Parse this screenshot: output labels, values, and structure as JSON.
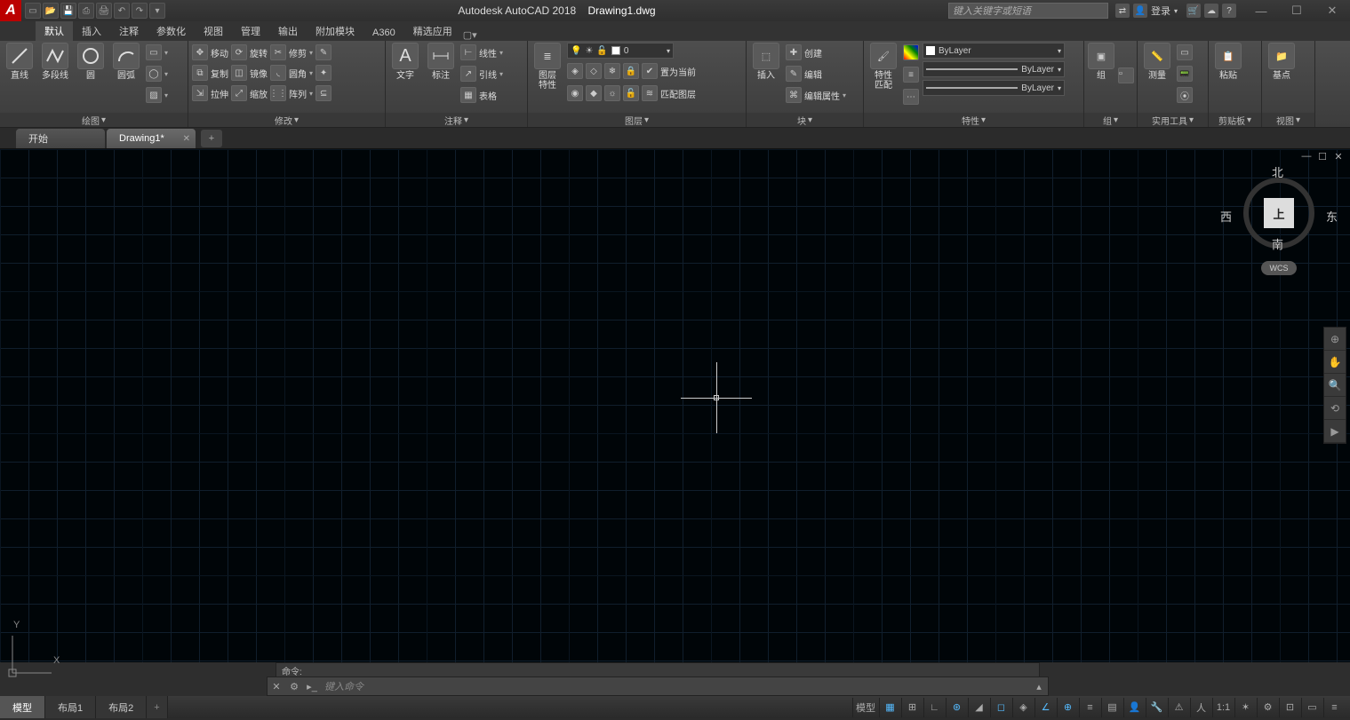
{
  "title": {
    "app": "Autodesk AutoCAD 2018",
    "file": "Drawing1.dwg"
  },
  "search": {
    "placeholder": "键入关键字或短语"
  },
  "login": {
    "label": "登录"
  },
  "window": {
    "min": "—",
    "max": "☐",
    "close": "✕"
  },
  "ribbon_tabs": [
    "默认",
    "插入",
    "注释",
    "参数化",
    "视图",
    "管理",
    "输出",
    "附加模块",
    "A360",
    "精选应用"
  ],
  "ribbon_tabs_active": 0,
  "panels": {
    "draw": {
      "title": "绘图",
      "big": [
        {
          "label": "直线",
          "icon": "line"
        },
        {
          "label": "多段线",
          "icon": "pline"
        },
        {
          "label": "圆",
          "icon": "circle"
        },
        {
          "label": "圆弧",
          "icon": "arc"
        }
      ]
    },
    "modify": {
      "title": "修改",
      "rows": [
        {
          "icon": "move",
          "label": "移动",
          "icon2": "rotate",
          "label2": "旋转",
          "icon3": "trim",
          "label3": "修剪"
        },
        {
          "icon": "copy",
          "label": "复制",
          "icon2": "mirror",
          "label2": "镜像",
          "icon3": "fillet",
          "label3": "圆角"
        },
        {
          "icon": "stretch",
          "label": "拉伸",
          "icon2": "scale",
          "label2": "缩放",
          "icon3": "array",
          "label3": "阵列"
        }
      ]
    },
    "annotate": {
      "title": "注释",
      "big": [
        {
          "label": "文字",
          "icon": "text"
        },
        {
          "label": "标注",
          "icon": "dim"
        }
      ],
      "rows": [
        {
          "label": "线性"
        },
        {
          "label": "引线"
        },
        {
          "label": "表格"
        }
      ]
    },
    "layers": {
      "title": "图层",
      "big_label": "图层\n特性",
      "current": "0",
      "rows": [
        {
          "label": "置为当前"
        },
        {
          "label": "匹配图层"
        }
      ]
    },
    "block": {
      "title": "块",
      "big_label": "插入",
      "rows": [
        {
          "label": "创建"
        },
        {
          "label": "编辑"
        },
        {
          "label": "编辑属性"
        }
      ]
    },
    "properties": {
      "title": "特性",
      "big_label": "特性\n匹配",
      "values": [
        "ByLayer",
        "ByLayer",
        "ByLayer"
      ]
    },
    "group": {
      "title": "组",
      "big_label": "组"
    },
    "utilities": {
      "title": "实用工具",
      "big_label": "测量"
    },
    "clipboard": {
      "title": "剪贴板",
      "big_label": "粘贴"
    },
    "view": {
      "title": "视图",
      "big_label": "基点"
    }
  },
  "doc_tabs": [
    {
      "label": "开始",
      "active": false
    },
    {
      "label": "Drawing1*",
      "active": true
    }
  ],
  "viewcube": {
    "n": "北",
    "s": "南",
    "e": "东",
    "w": "西",
    "top": "上",
    "wcs": "WCS"
  },
  "ucs": {
    "x": "X",
    "y": "Y"
  },
  "command": {
    "history": "命令:",
    "placeholder": "键入命令"
  },
  "layout_tabs": [
    {
      "label": "模型",
      "active": true
    },
    {
      "label": "布局1",
      "active": false
    },
    {
      "label": "布局2",
      "active": false
    }
  ],
  "status": {
    "model": "模型",
    "scale": "1:1"
  }
}
